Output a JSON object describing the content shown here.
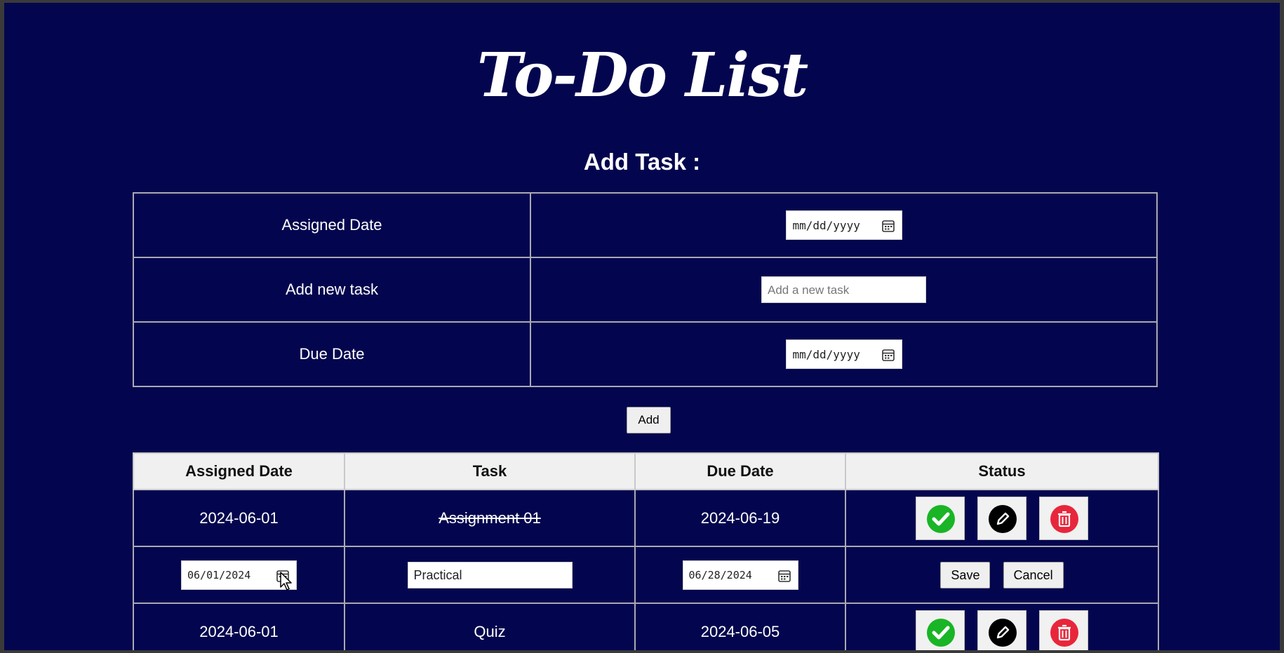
{
  "app": {
    "title": "To-Do List",
    "section_title": "Add Task :"
  },
  "form": {
    "assigned_label": "Assigned Date",
    "assigned_value": "mm/dd/yyyy",
    "task_label": "Add new task",
    "task_placeholder": "Add a new task",
    "due_label": "Due Date",
    "due_value": "mm/dd/yyyy",
    "add_button": "Add"
  },
  "table": {
    "headers": [
      "Assigned Date",
      "Task",
      "Due Date",
      "Status"
    ],
    "rows": [
      {
        "assigned": "2024-06-01",
        "task": "Assignment 01",
        "due": "2024-06-19",
        "completed": true
      },
      {
        "edit_assigned": "06/01/2024",
        "edit_task": "Practical",
        "edit_due": "06/28/2024",
        "save_label": "Save",
        "cancel_label": "Cancel"
      },
      {
        "assigned": "2024-06-01",
        "task": "Quiz",
        "due": "2024-06-05",
        "completed": false
      }
    ]
  },
  "icons": {
    "complete": "check-circle-icon",
    "edit": "pencil-icon",
    "delete": "trash-icon",
    "calendar": "calendar-icon"
  },
  "colors": {
    "background": "#03064e",
    "complete": "#19b526",
    "edit": "#000000",
    "delete": "#e8263b"
  }
}
